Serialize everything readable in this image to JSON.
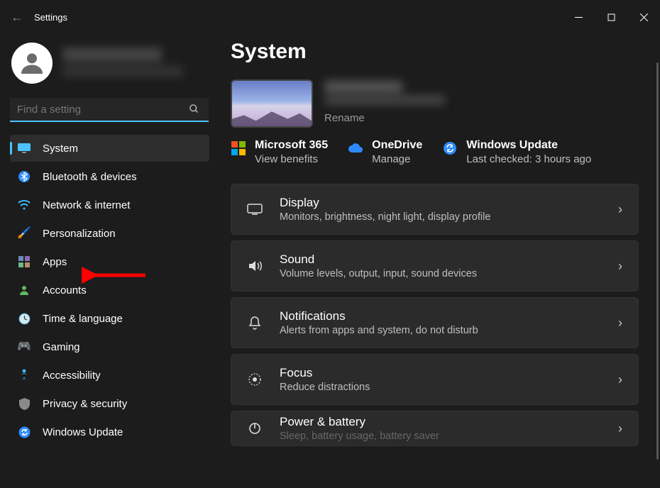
{
  "app": {
    "title": "Settings"
  },
  "search": {
    "placeholder": "Find a setting"
  },
  "sidebar": {
    "items": [
      {
        "label": "System",
        "icon": "🖥️",
        "selected": true
      },
      {
        "label": "Bluetooth & devices",
        "icon": "bt"
      },
      {
        "label": "Network & internet",
        "icon": "wifi"
      },
      {
        "label": "Personalization",
        "icon": "🖌️"
      },
      {
        "label": "Apps",
        "icon": "apps"
      },
      {
        "label": "Accounts",
        "icon": "👤"
      },
      {
        "label": "Time & language",
        "icon": "🕒"
      },
      {
        "label": "Gaming",
        "icon": "🎮"
      },
      {
        "label": "Accessibility",
        "icon": "acc"
      },
      {
        "label": "Privacy & security",
        "icon": "🛡️"
      },
      {
        "label": "Windows Update",
        "icon": "upd"
      }
    ]
  },
  "page": {
    "title": "System",
    "rename": "Rename",
    "quick": [
      {
        "title": "Microsoft 365",
        "sub": "View benefits"
      },
      {
        "title": "OneDrive",
        "sub": "Manage"
      },
      {
        "title": "Windows Update",
        "sub": "Last checked: 3 hours ago"
      }
    ],
    "cards": [
      {
        "title": "Display",
        "sub": "Monitors, brightness, night light, display profile",
        "icon": "display"
      },
      {
        "title": "Sound",
        "sub": "Volume levels, output, input, sound devices",
        "icon": "sound"
      },
      {
        "title": "Notifications",
        "sub": "Alerts from apps and system, do not disturb",
        "icon": "bell"
      },
      {
        "title": "Focus",
        "sub": "Reduce distractions",
        "icon": "focus"
      },
      {
        "title": "Power & battery",
        "sub": "Sleep, battery usage, battery saver",
        "icon": "power"
      }
    ]
  }
}
